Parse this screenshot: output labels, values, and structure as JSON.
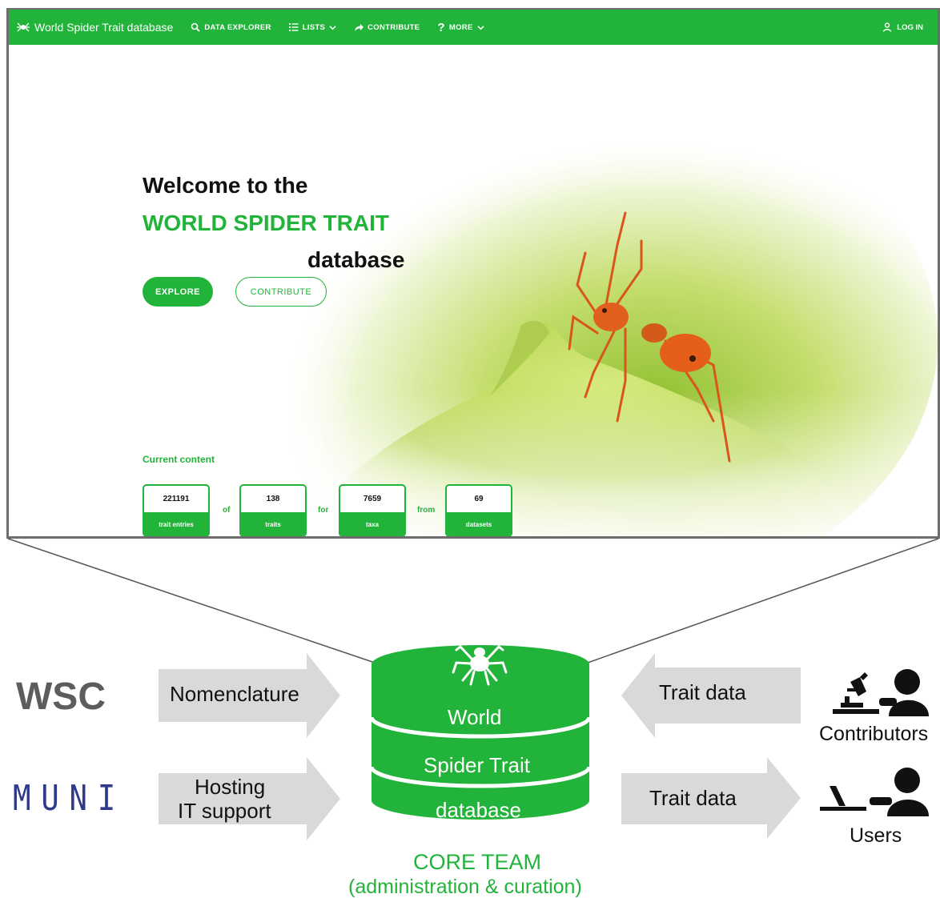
{
  "navbar": {
    "brand": "World Spider Trait database",
    "items": [
      {
        "label": "DATA EXPLORER",
        "icon": "search-icon"
      },
      {
        "label": "LISTS",
        "icon": "list-icon"
      },
      {
        "label": "CONTRIBUTE",
        "icon": "share-arrow-icon"
      },
      {
        "label": "MORE",
        "icon": "question-icon"
      }
    ],
    "login": "LOG IN",
    "color": "#22b33a"
  },
  "hero": {
    "line1": "Welcome to the",
    "line2": "WORLD SPIDER TRAIT",
    "line3": "database",
    "explore_button": "EXPLORE",
    "contribute_button": "CONTRIBUTE",
    "current_content_label": "Current content",
    "stats": [
      {
        "value": "221191",
        "label": "trait entries"
      },
      {
        "value": "138",
        "label": "traits"
      },
      {
        "value": "7659",
        "label": "taxa"
      },
      {
        "value": "69",
        "label": "datasets"
      }
    ],
    "connectors": [
      "of",
      "for",
      "from"
    ]
  },
  "diagram": {
    "left_sources": [
      {
        "name": "WSC",
        "arrow_label": "Nomenclature"
      },
      {
        "name": "MUNI",
        "arrow_label_line1": "Hosting",
        "arrow_label_line2": "IT support"
      }
    ],
    "database_layers": [
      "World",
      "Spider Trait",
      "database"
    ],
    "right": [
      {
        "arrow_label": "Trait data",
        "actor": "Contributors",
        "direction": "in"
      },
      {
        "arrow_label": "Trait data",
        "actor": "Users",
        "direction": "out"
      }
    ],
    "core_team_line1": "CORE TEAM",
    "core_team_line2": "(administration & curation)",
    "colors": {
      "green": "#22b33a",
      "arrow_gray": "#d9d9d9",
      "wsc_gray": "#5d5d5d",
      "muni_blue": "#2f3a8c"
    }
  }
}
